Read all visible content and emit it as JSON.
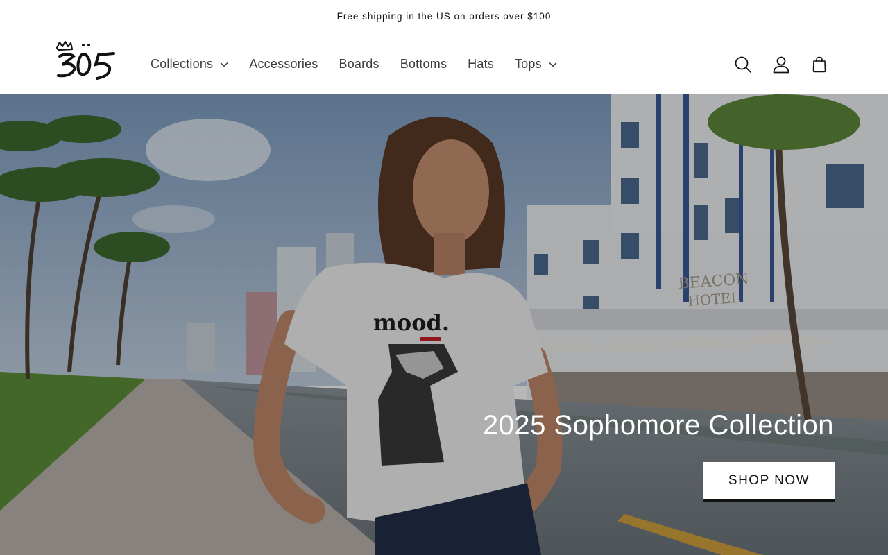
{
  "announcement": {
    "text": "Free shipping in the US on orders over $100"
  },
  "header": {
    "logo_alt": "305",
    "nav": [
      {
        "label": "Collections",
        "has_dropdown": true
      },
      {
        "label": "Accessories",
        "has_dropdown": false
      },
      {
        "label": "Boards",
        "has_dropdown": false
      },
      {
        "label": "Bottoms",
        "has_dropdown": false
      },
      {
        "label": "Hats",
        "has_dropdown": false
      },
      {
        "label": "Tops",
        "has_dropdown": true
      }
    ],
    "icons": [
      "search-icon",
      "account-icon",
      "cart-icon"
    ]
  },
  "hero": {
    "title": "2025 Sophomore Collection",
    "button_label": "SHOP NOW",
    "shirt_text": "mood.",
    "sign_text_1": "BEACON",
    "sign_text_2": "HOTEL"
  },
  "colors": {
    "text": "#121212",
    "nav_text": "#3d3d3d",
    "button_bg": "#ffffff",
    "hero_title": "#ffffff"
  }
}
